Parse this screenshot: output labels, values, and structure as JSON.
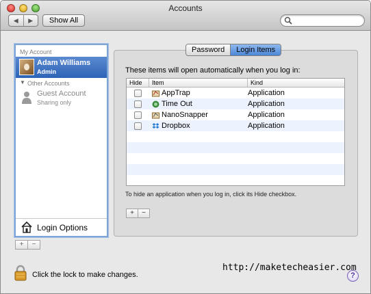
{
  "window": {
    "title": "Accounts"
  },
  "toolbar": {
    "back_glyph": "◀",
    "forward_glyph": "▶",
    "show_all_label": "Show All",
    "search_placeholder": ""
  },
  "sidebar": {
    "my_account_header": "My Account",
    "current_user": {
      "name": "Adam Williams",
      "role": "Admin",
      "icon": "user-photo"
    },
    "other_accounts_header": "Other Accounts",
    "disclosure_glyph": "▼",
    "guest": {
      "name": "Guest Account",
      "subtitle": "Sharing only",
      "icon": "person-silhouette-icon"
    },
    "login_options_label": "Login Options",
    "add_glyph": "+",
    "remove_glyph": "−"
  },
  "tabs": [
    {
      "label": "Password",
      "active": false
    },
    {
      "label": "Login Items",
      "active": true
    }
  ],
  "login_items": {
    "intro": "These items will open automatically when you log in:",
    "columns": {
      "hide": "Hide",
      "item": "Item",
      "kind": "Kind"
    },
    "rows": [
      {
        "name": "AppTrap",
        "kind": "Application",
        "hidden": false,
        "icon": "apptrap-icon"
      },
      {
        "name": "Time Out",
        "kind": "Application",
        "hidden": false,
        "icon": "timeout-icon"
      },
      {
        "name": "NanoSnapper",
        "kind": "Application",
        "hidden": false,
        "icon": "nanosnapper-icon"
      },
      {
        "name": "Dropbox",
        "kind": "Application",
        "hidden": false,
        "icon": "dropbox-icon"
      }
    ],
    "hint": "To hide an application when you log in, click its Hide checkbox.",
    "add_glyph": "+",
    "remove_glyph": "−"
  },
  "footer": {
    "lock_text": "Click the lock to make changes.",
    "watermark": "http://maketecheasier.com",
    "help_glyph": "?"
  },
  "colors": {
    "selection": "#2d63b7",
    "alt_row": "#edf3fe",
    "active_tab": "#4b86d6"
  }
}
